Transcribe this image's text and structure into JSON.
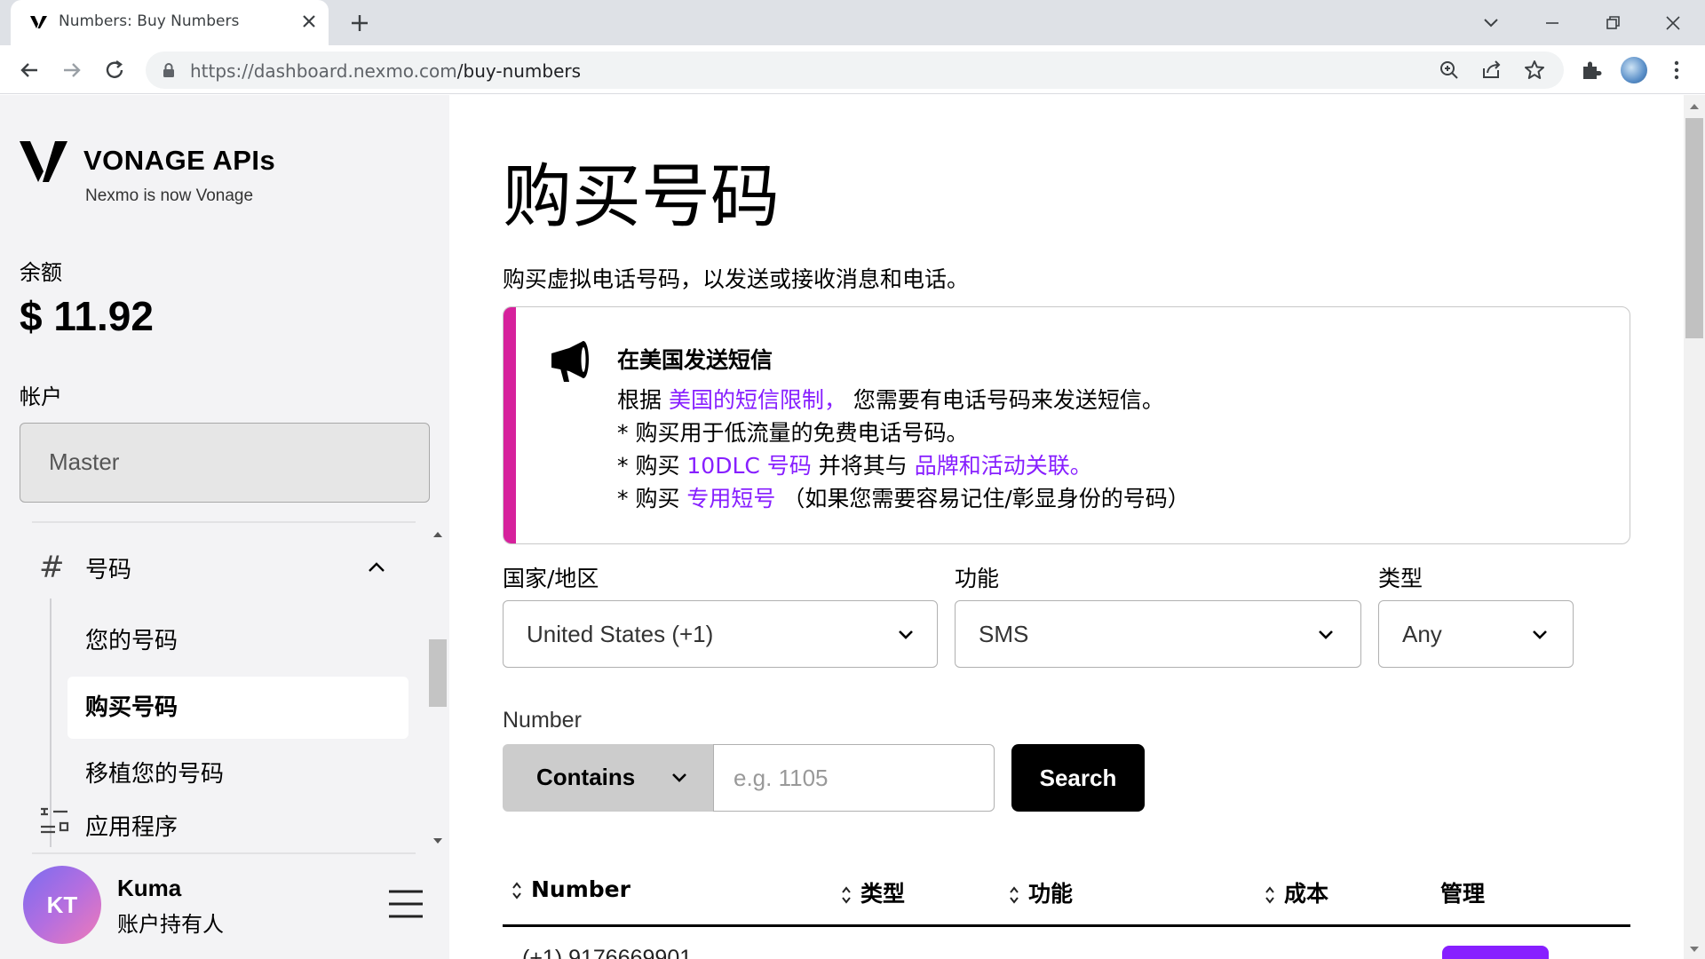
{
  "browser": {
    "tab_title": "Numbers: Buy Numbers",
    "url_host": "https://dashboard.nexmo.com",
    "url_path": "/buy-numbers"
  },
  "sidebar": {
    "brand": "VONAGE APIs",
    "brand_sub": "Nexmo is now Vonage",
    "balance_label": "余额",
    "balance_value": "$ 11.92",
    "account_label": "帐户",
    "account_value": "Master",
    "nav": {
      "group_label": "号码",
      "items": [
        {
          "label": "您的号码"
        },
        {
          "label": "购买号码",
          "active": true
        },
        {
          "label": "移植您的号码"
        }
      ],
      "apps_label": "应用程序"
    },
    "user": {
      "initials": "KT",
      "name": "Kuma",
      "role": "账户持有人"
    }
  },
  "main": {
    "title": "购买号码",
    "description": "购买虚拟电话号码，以发送或接收消息和电话。",
    "notice": {
      "title": "在美国发送短信",
      "line1_pre": "根据 ",
      "line1_link": "美国的短信限制，",
      "line1_post": " 您需要有电话号码来发送短信。",
      "line2": "* 购买用于低流量的免费电话号码。",
      "line3_pre": "* 购买 ",
      "line3_link1": "10DLC 号码",
      "line3_mid": " 并将其与 ",
      "line3_link2": "品牌和活动关联。",
      "line4_pre": "* 购买 ",
      "line4_link": "专用短号",
      "line4_post": " （如果您需要容易记住/彰显身份的号码）"
    },
    "filters": {
      "country_label": "国家/地区",
      "country_value": "United States (+1)",
      "feature_label": "功能",
      "feature_value": "SMS",
      "type_label": "类型",
      "type_value": "Any"
    },
    "number_search": {
      "label": "Number",
      "mode": "Contains",
      "placeholder": "e.g. 1105",
      "button": "Search"
    },
    "table": {
      "headers": [
        "Number",
        "类型",
        "功能",
        "成本",
        "管理"
      ],
      "first_row_number_partial": "(+1) 9176669901"
    }
  },
  "colors": {
    "accent_link": "#871fff",
    "notice_bar": "#d6219c",
    "search_button": "#000000"
  }
}
